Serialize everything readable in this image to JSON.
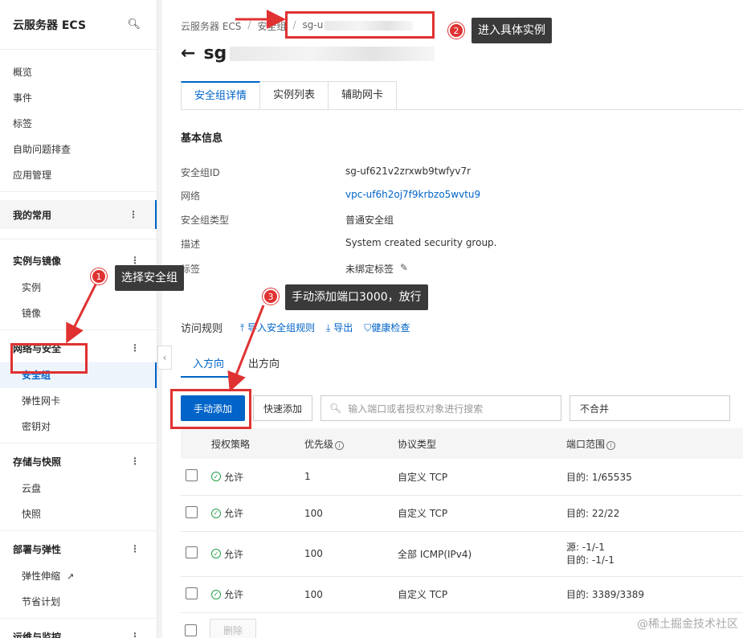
{
  "sidebar": {
    "title": "云服务器 ECS",
    "top_items": [
      "概览",
      "事件",
      "标签",
      "自助问题排查",
      "应用管理"
    ],
    "favorite_group": "我的常用",
    "groups": [
      {
        "label": "实例与镜像",
        "items": [
          "实例",
          "镜像"
        ]
      },
      {
        "label": "网络与安全",
        "items": [
          "安全组",
          "弹性网卡",
          "密钥对"
        ]
      },
      {
        "label": "存储与快照",
        "items": [
          "云盘",
          "快照"
        ]
      },
      {
        "label": "部署与弹性",
        "items": [
          "弹性伸缩",
          "节省计划"
        ]
      },
      {
        "label": "运维与监控",
        "items": []
      }
    ]
  },
  "breadcrumb": {
    "root": "云服务器 ECS",
    "parent": "安全组",
    "current": "sg-u"
  },
  "page": {
    "title": "sg"
  },
  "tabs": [
    "安全组详情",
    "实例列表",
    "辅助网卡"
  ],
  "basic_info": {
    "title": "基本信息",
    "rows": [
      {
        "label": "安全组ID",
        "value": "sg-uf621v2zrxwb9twfyv7r"
      },
      {
        "label": "网络",
        "value": "vpc-uf6h2oj7f9krbzo5wvtu9"
      },
      {
        "label": "安全组类型",
        "value": "普通安全组"
      },
      {
        "label": "描述",
        "value": "System created security group."
      },
      {
        "label": "标签",
        "value": "未绑定标签"
      }
    ]
  },
  "rules": {
    "title": "访问规则",
    "links": [
      "导入安全组规则",
      "导出",
      "健康检查"
    ],
    "subtabs": [
      "入方向",
      "出方向"
    ],
    "add_button": "手动添加",
    "quick_add_button": "快速添加",
    "search_placeholder": "输入端口或者授权对象进行搜索",
    "merge_select": "不合并",
    "columns": [
      "授权策略",
      "优先级",
      "协议类型",
      "端口范围"
    ],
    "rows": [
      {
        "policy": "允许",
        "priority": "1",
        "protocol": "自定义 TCP",
        "port": [
          "目的: 1/65535"
        ]
      },
      {
        "policy": "允许",
        "priority": "100",
        "protocol": "自定义 TCP",
        "port": [
          "目的: 22/22"
        ]
      },
      {
        "policy": "允许",
        "priority": "100",
        "protocol": "全部 ICMP(IPv4)",
        "port": [
          "源: -1/-1",
          "目的: -1/-1"
        ]
      },
      {
        "policy": "允许",
        "priority": "100",
        "protocol": "自定义 TCP",
        "port": [
          "目的: 3389/3389"
        ]
      }
    ],
    "delete_button": "删除"
  },
  "annotations": {
    "a1": {
      "num": "1",
      "text": "选择安全组"
    },
    "a2": {
      "num": "2",
      "text": "进入具体实例"
    },
    "a3": {
      "num": "3",
      "text": "手动添加端口3000，放行"
    },
    "color": "#e03131"
  },
  "watermark": "@稀土掘金技术社区"
}
